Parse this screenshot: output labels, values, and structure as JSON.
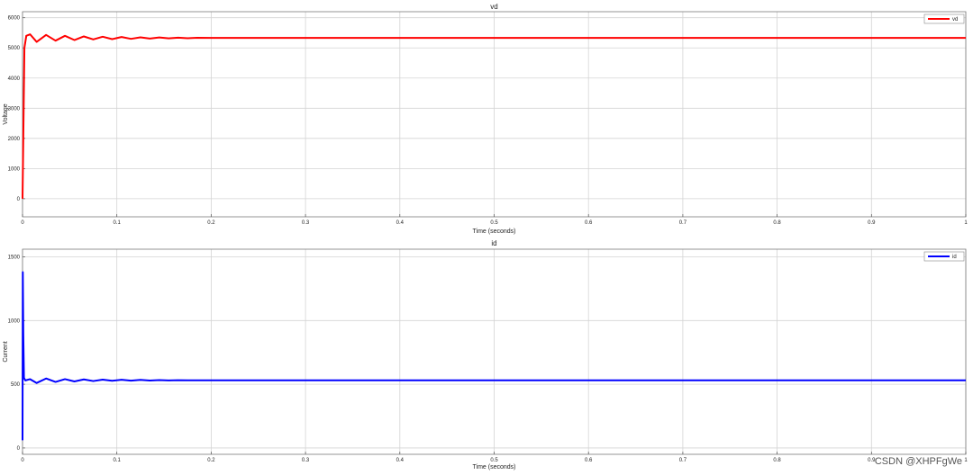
{
  "watermark": "CSDN @XHPFgWe",
  "chart_data": [
    {
      "type": "line",
      "title": "vd",
      "xlabel": "Time (seconds)",
      "ylabel": "Voltage",
      "xlim": [
        0,
        1
      ],
      "ylim": [
        -600,
        6200
      ],
      "grid": true,
      "legend_position": "top-right",
      "x_ticks": [
        0,
        0.1,
        0.2,
        0.3,
        0.4,
        0.5,
        0.6,
        0.7,
        0.8,
        0.9,
        1
      ],
      "x_tick_labels": [
        "0",
        "0.1",
        "0.2",
        "0.3",
        "0.4",
        "0.5",
        "0.6",
        "0.7",
        "0.8",
        "0.9",
        "1"
      ],
      "y_ticks": [
        0,
        1000,
        2000,
        3000,
        4000,
        5000,
        6000
      ],
      "y_tick_labels": [
        "0",
        "1000",
        "2000",
        "3000",
        "4000",
        "5000",
        "6000"
      ],
      "series": [
        {
          "name": "vd",
          "color": "#ff0000",
          "x": [
            0,
            0.001,
            0.002,
            0.004,
            0.008,
            0.015,
            0.025,
            0.035,
            0.045,
            0.055,
            0.065,
            0.075,
            0.085,
            0.095,
            0.105,
            0.115,
            0.125,
            0.135,
            0.145,
            0.155,
            0.165,
            0.175,
            0.185,
            0.2,
            0.25,
            0.3,
            0.4,
            0.5,
            0.6,
            0.7,
            0.8,
            0.9,
            1.0
          ],
          "y": [
            0,
            2500,
            5000,
            5400,
            5450,
            5200,
            5430,
            5240,
            5400,
            5260,
            5380,
            5280,
            5370,
            5290,
            5360,
            5300,
            5350,
            5310,
            5345,
            5315,
            5340,
            5320,
            5335,
            5330,
            5330,
            5330,
            5330,
            5330,
            5330,
            5330,
            5330,
            5330,
            5330
          ]
        }
      ]
    },
    {
      "type": "line",
      "title": "id",
      "xlabel": "Time (seconds)",
      "ylabel": "Current",
      "xlim": [
        0,
        1
      ],
      "ylim": [
        -50,
        1560
      ],
      "grid": true,
      "legend_position": "top-right",
      "x_ticks": [
        0,
        0.1,
        0.2,
        0.3,
        0.4,
        0.5,
        0.6,
        0.7,
        0.8,
        0.9,
        1
      ],
      "x_tick_labels": [
        "0",
        "0.1",
        "0.2",
        "0.3",
        "0.4",
        "0.5",
        "0.6",
        "0.7",
        "0.8",
        "0.9",
        "1"
      ],
      "y_ticks": [
        0,
        500,
        1000,
        1500
      ],
      "y_tick_labels": [
        "0",
        "500",
        "1000",
        "1500"
      ],
      "series": [
        {
          "name": "id",
          "color": "#0000ff",
          "x": [
            0,
            0.0003,
            0.0008,
            0.0015,
            0.003,
            0.008,
            0.015,
            0.025,
            0.035,
            0.045,
            0.055,
            0.065,
            0.075,
            0.085,
            0.095,
            0.105,
            0.115,
            0.125,
            0.135,
            0.145,
            0.155,
            0.165,
            0.175,
            0.2,
            0.3,
            0.4,
            0.5,
            0.6,
            0.7,
            0.8,
            0.9,
            1.0
          ],
          "y": [
            60,
            1380,
            900,
            550,
            530,
            540,
            510,
            545,
            518,
            540,
            522,
            538,
            525,
            536,
            527,
            535,
            528,
            534,
            529,
            533,
            530,
            532,
            531,
            531,
            531,
            531,
            531,
            531,
            531,
            531,
            531,
            531
          ]
        }
      ]
    }
  ]
}
